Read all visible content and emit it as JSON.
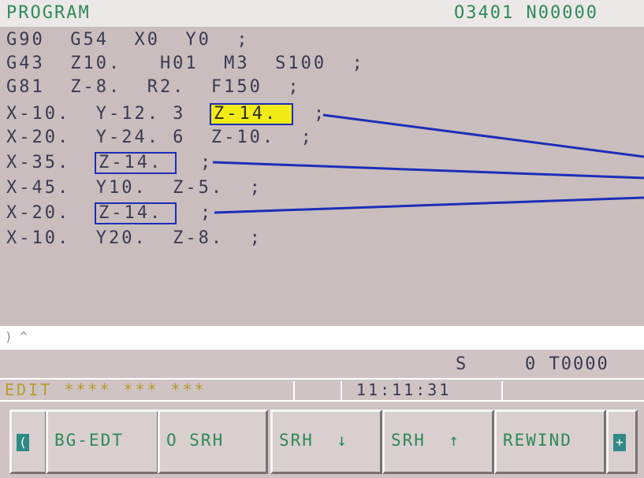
{
  "header": {
    "title": "PROGRAM",
    "program_number": "O3401 N00000"
  },
  "program_lines": [
    "G90  G54  X0  Y0  ;",
    "G43  Z10.   H01  M3  S100  ;",
    "G81  Z-8.  R2.  F150  ;",
    "X-10.  Y-12. 3",
    "X-20.  Y-24. 6  Z-10.  ;",
    "X-35.",
    "X-45.  Y10.  Z-5.  ;",
    "X-20.",
    "X-10.  Y20.  Z-8.  ;"
  ],
  "boxed_words": {
    "line4": "Z-14.",
    "line6": "Z-14.",
    "line8": "Z-14."
  },
  "line_ends": {
    "line4": ";",
    "line6": ";",
    "line8": ";"
  },
  "input_buffer": ") ^",
  "status": {
    "spindle_label": "S",
    "spindle_value": "0",
    "tool": "T0000",
    "mode": "EDIT  ****  ***  ***",
    "clock": "11:11:31"
  },
  "softkeys": {
    "left_arrow": "(",
    "bg_edit": "BG-EDT",
    "o_search": "O SRH",
    "search_down": "SRH  ↓",
    "search_up": "SRH  ↑",
    "rewind": "REWIND",
    "right_arrow": "+"
  },
  "colors": {
    "highlight": "#f2ec14",
    "box_border": "#1e2db8",
    "accent_green": "#2d8a57",
    "mode_text": "#b59c2a"
  }
}
